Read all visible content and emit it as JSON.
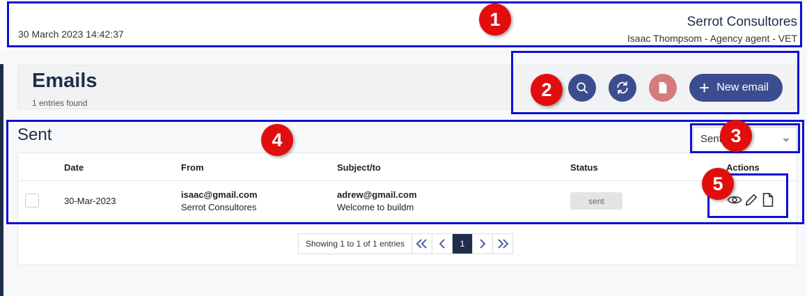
{
  "header": {
    "datetime": "30 March 2023 14:42:37",
    "company": "Serrot Consultores",
    "user_line": "Isaac Thompsom - Agency agent - VET"
  },
  "page": {
    "title": "Emails",
    "entries_found": "1 entries found"
  },
  "toolbar": {
    "new_email_label": "New email",
    "search_icon": "search-icon",
    "refresh_icon": "refresh-icon",
    "document_icon": "document-icon",
    "colors": {
      "primary": "#3c4d8f",
      "danger_soft": "#d47b7b",
      "navy": "#1f2d4a"
    }
  },
  "section": {
    "title": "Sent",
    "filter_value": "Sent"
  },
  "table": {
    "columns": [
      "Date",
      "From",
      "Subject/to",
      "Status",
      "Actions"
    ],
    "rows": [
      {
        "date": "30-Mar-2023",
        "from_email": "isaac@gmail.com",
        "from_name": "Serrot Consultores",
        "to_email": "adrew@gmail.com",
        "subject": "Welcome to buildm",
        "status": "sent"
      }
    ]
  },
  "pagination": {
    "info": "Showing 1 to 1 of 1 entries",
    "current_page": "1"
  },
  "annotations": [
    "1",
    "2",
    "3",
    "4",
    "5"
  ]
}
